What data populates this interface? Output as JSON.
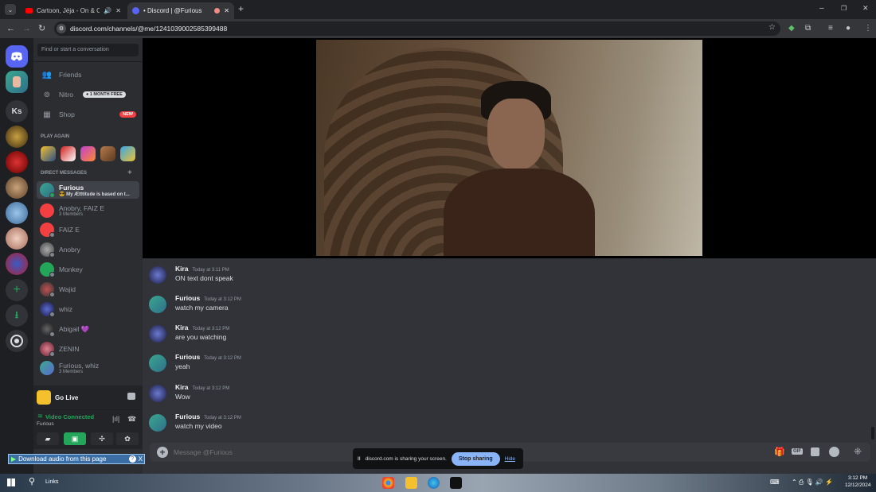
{
  "browser": {
    "tabs": [
      {
        "title": "Cartoon, Jéja - On & On (l|",
        "active": false
      },
      {
        "title": "• Discord | @Furious",
        "active": true
      }
    ],
    "new_tab": "+",
    "url": "discord.com/channels/@me/1241039002585399488",
    "window_controls": [
      "–",
      "❐",
      "✕"
    ]
  },
  "servers": {
    "items": [
      {
        "kind": "discord-home"
      },
      {
        "kind": "avatar"
      },
      {
        "kind": "text",
        "label": "Ks"
      },
      {
        "kind": "image"
      },
      {
        "kind": "image"
      },
      {
        "kind": "image"
      },
      {
        "kind": "image"
      },
      {
        "kind": "image"
      },
      {
        "kind": "image"
      }
    ],
    "add_label": "+",
    "download_label": "⭳"
  },
  "dm": {
    "search_placeholder": "Find or start a conversation",
    "friends": "Friends",
    "nitro": "Nitro",
    "nitro_badge": "1 MONTH FREE",
    "shop": "Shop",
    "shop_badge": "NEW",
    "play_again": "PLAY AGAIN",
    "direct_messages": "DIRECT MESSAGES",
    "add": "+",
    "items": [
      {
        "name": "Furious",
        "sub": "😎 My Ætttitude is based on t...",
        "selected": true
      },
      {
        "name": "Anobry, FAIZ E",
        "sub": "3 Members"
      },
      {
        "name": "FAIZ E",
        "sub": ""
      },
      {
        "name": "Anobry",
        "sub": ""
      },
      {
        "name": "Monkey",
        "sub": ""
      },
      {
        "name": "Wajid",
        "sub": ""
      },
      {
        "name": "whiz",
        "sub": ""
      },
      {
        "name": "Abigail 💜",
        "sub": ""
      },
      {
        "name": "ZENIN",
        "sub": ""
      },
      {
        "name": "Furious, whiz",
        "sub": "3 Members"
      }
    ],
    "go_live": "Go Live",
    "video_connected": "Video Connected",
    "connected_user": "Furious"
  },
  "messages": [
    {
      "author": "Kira",
      "time": "Today at 3:11 PM",
      "text": "ON text dont speak"
    },
    {
      "author": "Furious",
      "time": "Today at 3:12 PM",
      "text": "watch my camera"
    },
    {
      "author": "Kira",
      "time": "Today at 3:12 PM",
      "text": "are you watching"
    },
    {
      "author": "Furious",
      "time": "Today at 3:12 PM",
      "text": "yeah"
    },
    {
      "author": "Kira",
      "time": "Today at 3:12 PM",
      "text": "Wow"
    },
    {
      "author": "Furious",
      "time": "Today at 3:12 PM",
      "text": "watch my video"
    }
  ],
  "composer": {
    "placeholder": "Message @Furious",
    "gif": "GIF"
  },
  "share_bar": {
    "pause": "II",
    "text": "discord.com is sharing your screen.",
    "stop": "Stop sharing",
    "hide": "Hide"
  },
  "download_bar": {
    "label": "Download audio from this page",
    "help": "?",
    "close": "X"
  },
  "taskbar": {
    "search": "Links",
    "time": "3:12 PM",
    "date": "12/12/2024"
  },
  "colors": {
    "blurple": "#5865f2",
    "green": "#23a55a",
    "red": "#f23f42"
  }
}
